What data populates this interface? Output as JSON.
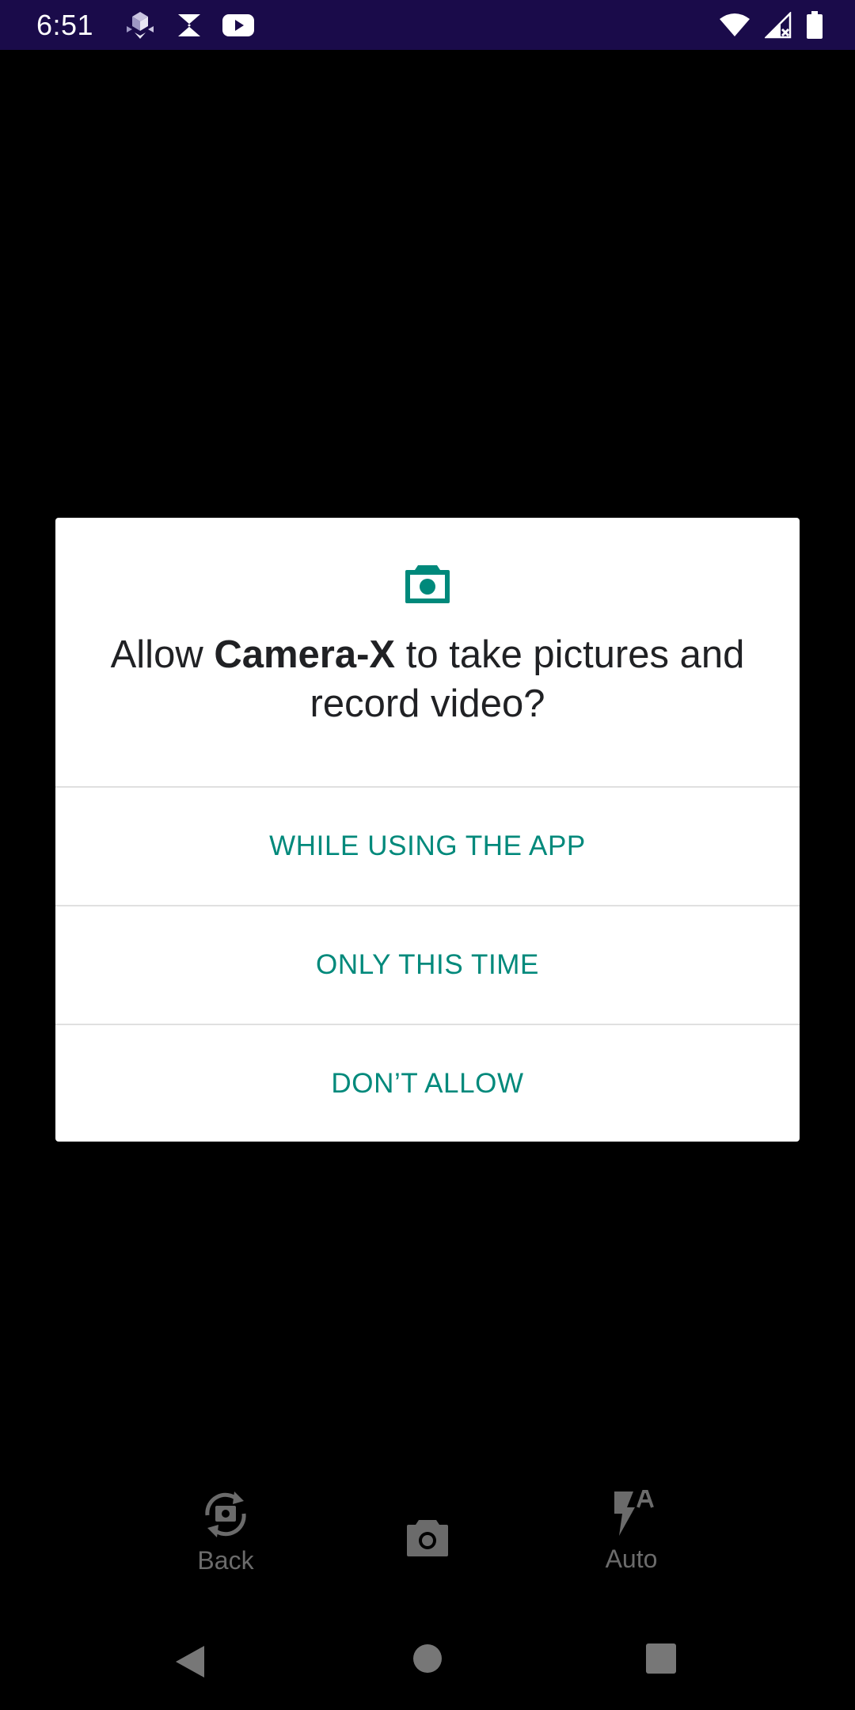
{
  "status_bar": {
    "time": "6:51",
    "left_icons": [
      "cube-app-icon",
      "s-app-icon",
      "youtube-icon"
    ],
    "right_icons": [
      "wifi-icon",
      "signal-icon",
      "battery-icon"
    ]
  },
  "dialog": {
    "icon": "camera-icon",
    "title_prefix": "Allow ",
    "app_name": "Camera-X",
    "title_suffix": " to take pictures and record video?",
    "options": [
      {
        "label": "WHILE USING THE APP"
      },
      {
        "label": "ONLY THIS TIME"
      },
      {
        "label": "DON’T ALLOW"
      }
    ],
    "accent_color": "#00897b"
  },
  "camera_controls": {
    "switch_camera_label": "Back",
    "flash_label": "Auto"
  },
  "colors": {
    "status_bar_bg": "#1a0b4a",
    "background": "#000000",
    "control_gray": "#6b6b6b"
  }
}
